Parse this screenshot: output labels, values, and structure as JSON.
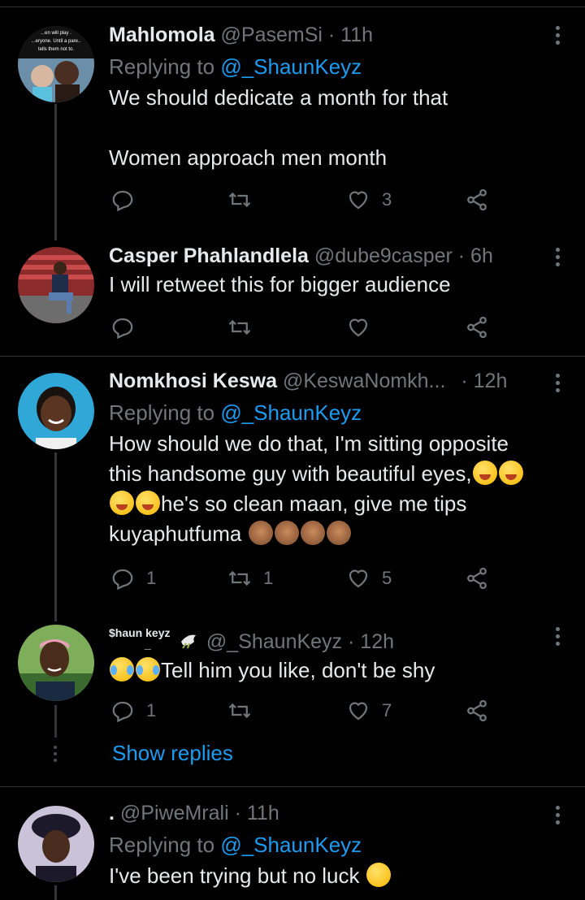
{
  "tweets": [
    {
      "name": "Mahlomola",
      "handle": "@PasemSi",
      "time": "· 11h",
      "avatar_text": "...en will play. ...eryone. Until a pare... tells them not to.",
      "replying_prefix": "Replying to ",
      "replying_to": "@_ShaunKeyz",
      "text_lines": [
        "We should dedicate a month for that",
        "",
        "Women approach men month"
      ],
      "reply_count": "",
      "retweet_count": "",
      "like_count": "3"
    },
    {
      "name": "Casper Phahlandlela",
      "handle": "@dube9casper",
      "time": "· 6h",
      "text_lines": [
        "I will retweet this for bigger audience"
      ],
      "reply_count": "",
      "retweet_count": "",
      "like_count": ""
    },
    {
      "name": "Nomkhosi Keswa",
      "handle": "@KeswaNomkh...",
      "time": "· 12h",
      "replying_prefix": "Replying to ",
      "replying_to": "@_ShaunKeyz",
      "text_lines": [
        "How should we do that, I'm sitting opposite",
        "this handsome guy with beautiful eyes,",
        "he's so clean maan, give me tips",
        "kuyaphutfuma"
      ],
      "reply_count": "1",
      "retweet_count": "1",
      "like_count": "5"
    },
    {
      "name": "$haun keyz",
      "name_sub": "_",
      "handle": "@_ShaunKeyz",
      "time": "· 12h",
      "text_lines": [
        "Tell him you like, don't be shy"
      ],
      "reply_count": "1",
      "retweet_count": "",
      "like_count": "7"
    },
    {
      "name": ".",
      "handle": "@PiweMrali",
      "time": "· 11h",
      "replying_prefix": "Replying to ",
      "replying_to": "@_ShaunKeyz",
      "text_lines": [
        "I've been trying but no luck"
      ]
    }
  ],
  "show_replies": "Show replies",
  "colors": {
    "background": "#000000",
    "text": "#e7e9ea",
    "muted": "#71767b",
    "accent": "#1d9bf0",
    "divider": "#2f3336"
  },
  "icons": [
    "reply-icon",
    "retweet-icon",
    "like-icon",
    "share-icon",
    "more-icon"
  ]
}
